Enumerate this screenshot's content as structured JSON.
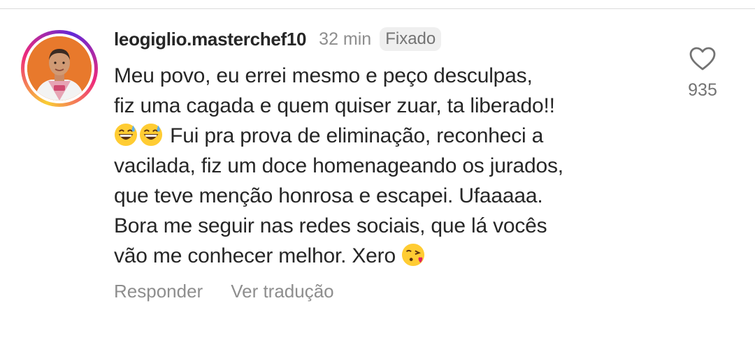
{
  "comment": {
    "username": "leogiglio.masterchef10",
    "time": "32 min",
    "pinned_label": "Fixado",
    "lines": [
      "Meu povo, eu errei mesmo e peço desculpas,",
      "fiz uma cagada e quem quiser zuar, ta liberado!!",
      "Fui pra prova de eliminação, reconheci a",
      "vacilada, fiz um doce homenageando os jurados,",
      "que teve menção honrosa e escapei. Ufaaaaa.",
      "Bora me seguir nas redes sociais, que lá vocês",
      "vão me conhecer melhor. Xero"
    ],
    "reply_label": "Responder",
    "translate_label": "Ver tradução",
    "like_count": "935"
  },
  "icons": {
    "like": "heart-outline-icon",
    "emoji_sweat": "grinning-face-with-sweat-emoji",
    "emoji_kiss": "face-blowing-a-kiss-emoji"
  },
  "colors": {
    "text": "#262626",
    "secondary": "#8e8e8e",
    "badge_bg": "#efefef",
    "avatar_bg": "#e8792c"
  }
}
